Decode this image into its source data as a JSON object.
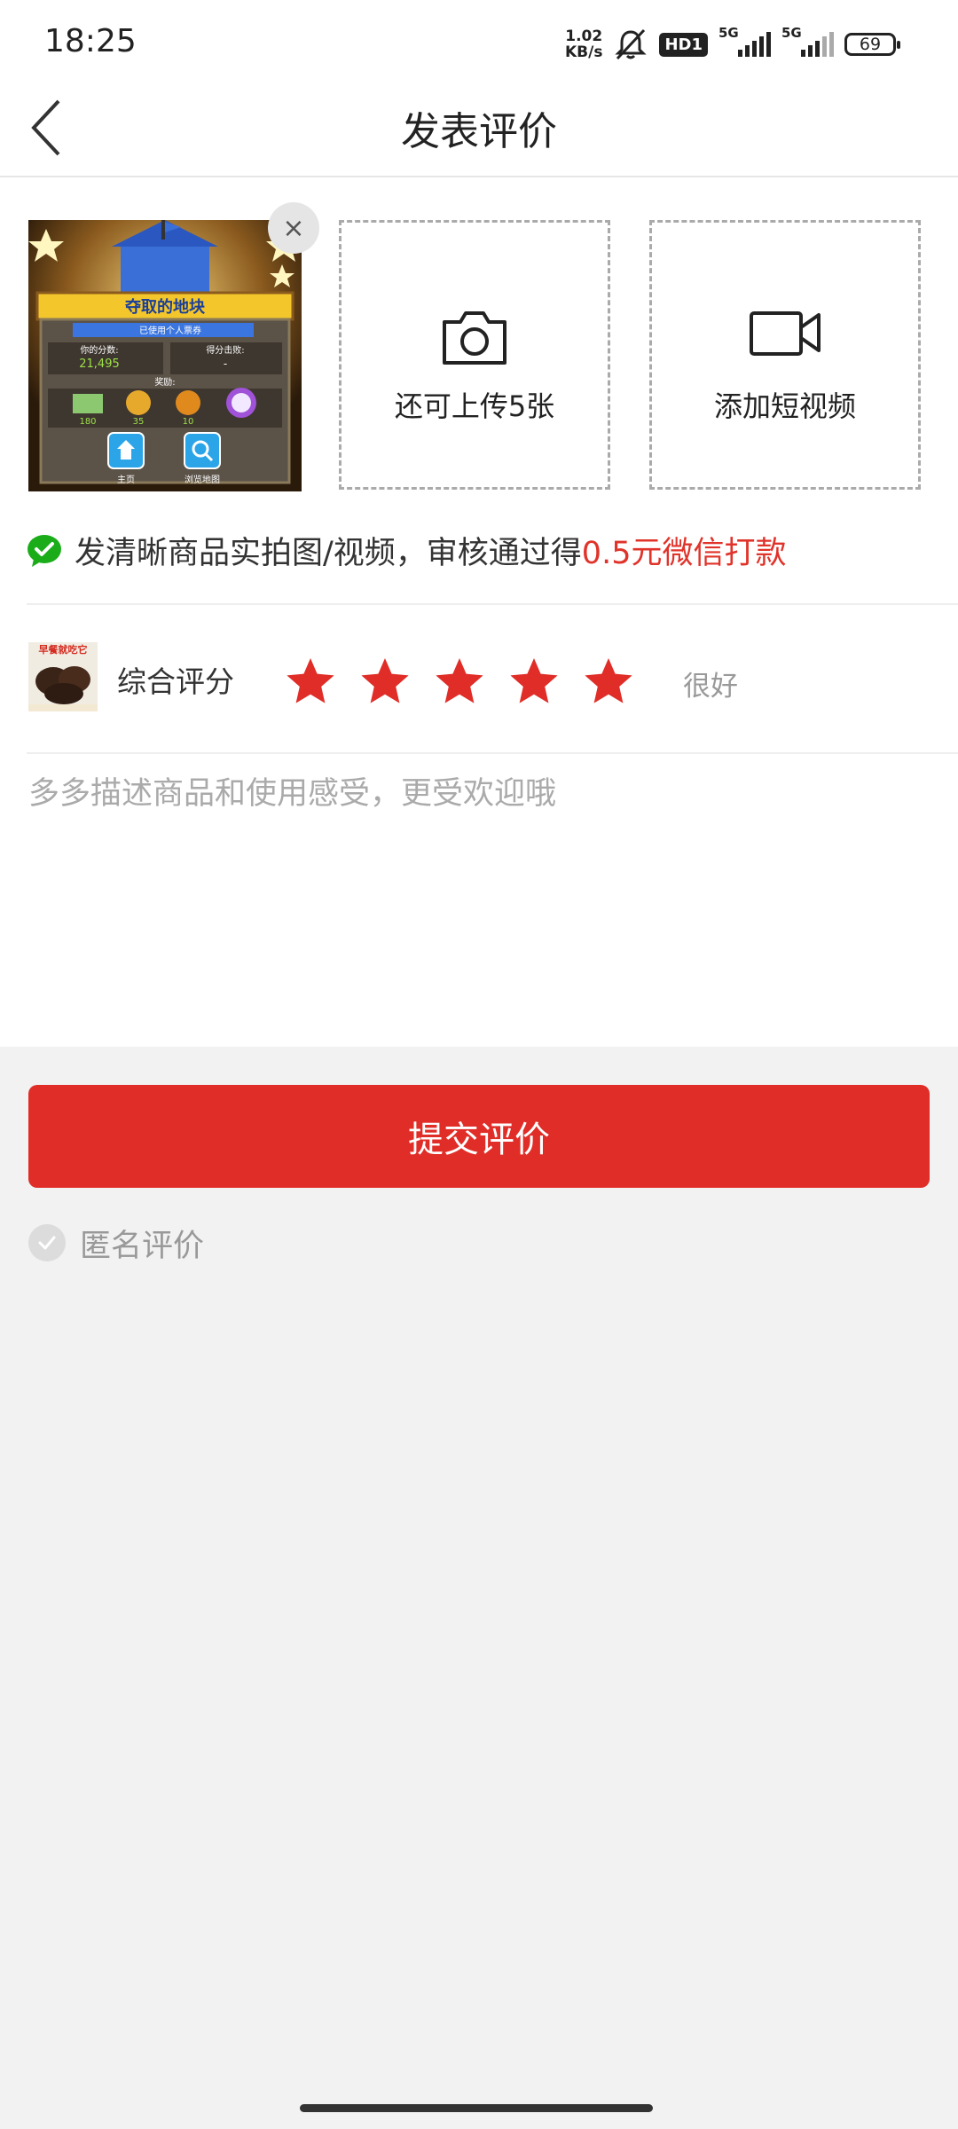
{
  "status_bar": {
    "time": "18:25",
    "net_speed_value": "1.02",
    "net_speed_unit": "KB/s",
    "hd_badge": "HD1",
    "sim1": "5G",
    "sim2": "5G",
    "battery": "69"
  },
  "header": {
    "title": "发表评价"
  },
  "media": {
    "upload_photo_label": "还可上传5张",
    "add_video_label": "添加短视频",
    "remove_icon": "×",
    "thumbnail_texts": {
      "title": "夺取的地块",
      "banner": "已使用个人票券",
      "score_label": "你的分数:",
      "score_value": "21,495",
      "rank_label": "得分击败:",
      "rank_value": "-",
      "reward_label": "奖励:",
      "reward_values": [
        "180",
        "35",
        "10"
      ],
      "home_label": "主页",
      "map_label": "浏览地图"
    }
  },
  "tip": {
    "text": "发清晰商品实拍图/视频，审核通过得",
    "highlight": "0.5元微信打款",
    "icon": "wechat-icon",
    "highlight_color": "#e0332a"
  },
  "rating": {
    "product_banner": "早餐就吃它",
    "label": "综合评分",
    "stars": 5,
    "max_stars": 5,
    "text": "很好",
    "star_color": "#e02d27"
  },
  "review": {
    "placeholder": "多多描述商品和使用感受，更受欢迎哦",
    "value": ""
  },
  "submit": {
    "label": "提交评价",
    "color": "#e02d27"
  },
  "anonymous": {
    "label": "匿名评价",
    "checked": false
  }
}
